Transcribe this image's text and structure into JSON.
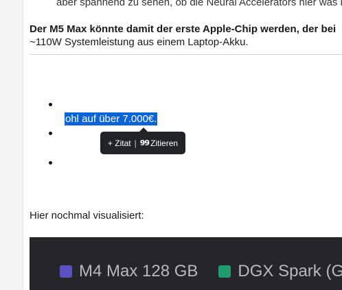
{
  "article": {
    "fragment_text": "aber spannend zu sehen, ob die Neural Accelerators hier was re",
    "bold_sentence": "Der M5 Max könnte damit der erste Apple-Chip werden, der bei",
    "after_bold": "~110W Systemleistung aus einem Laptop-Akku.",
    "selected_text": "ohl auf über 7.000€.",
    "visualized_label": "Hier nochmal visualisiert:"
  },
  "tooltip": {
    "add_quote_label": "+ Zitat",
    "separator": "|",
    "quote_label": "Zitieren",
    "quote_icon_glyph": "99"
  },
  "chart_data": {
    "type": "bar",
    "legend": [
      {
        "name": "M4 Max 128 GB",
        "color": "#5b4fc4"
      },
      {
        "name": "DGX Spark (G",
        "color": "#1e9c6e"
      }
    ]
  },
  "colors": {
    "selection": "#0a64d8",
    "tooltip_bg": "#222326",
    "chart_bg": "#26262a"
  }
}
